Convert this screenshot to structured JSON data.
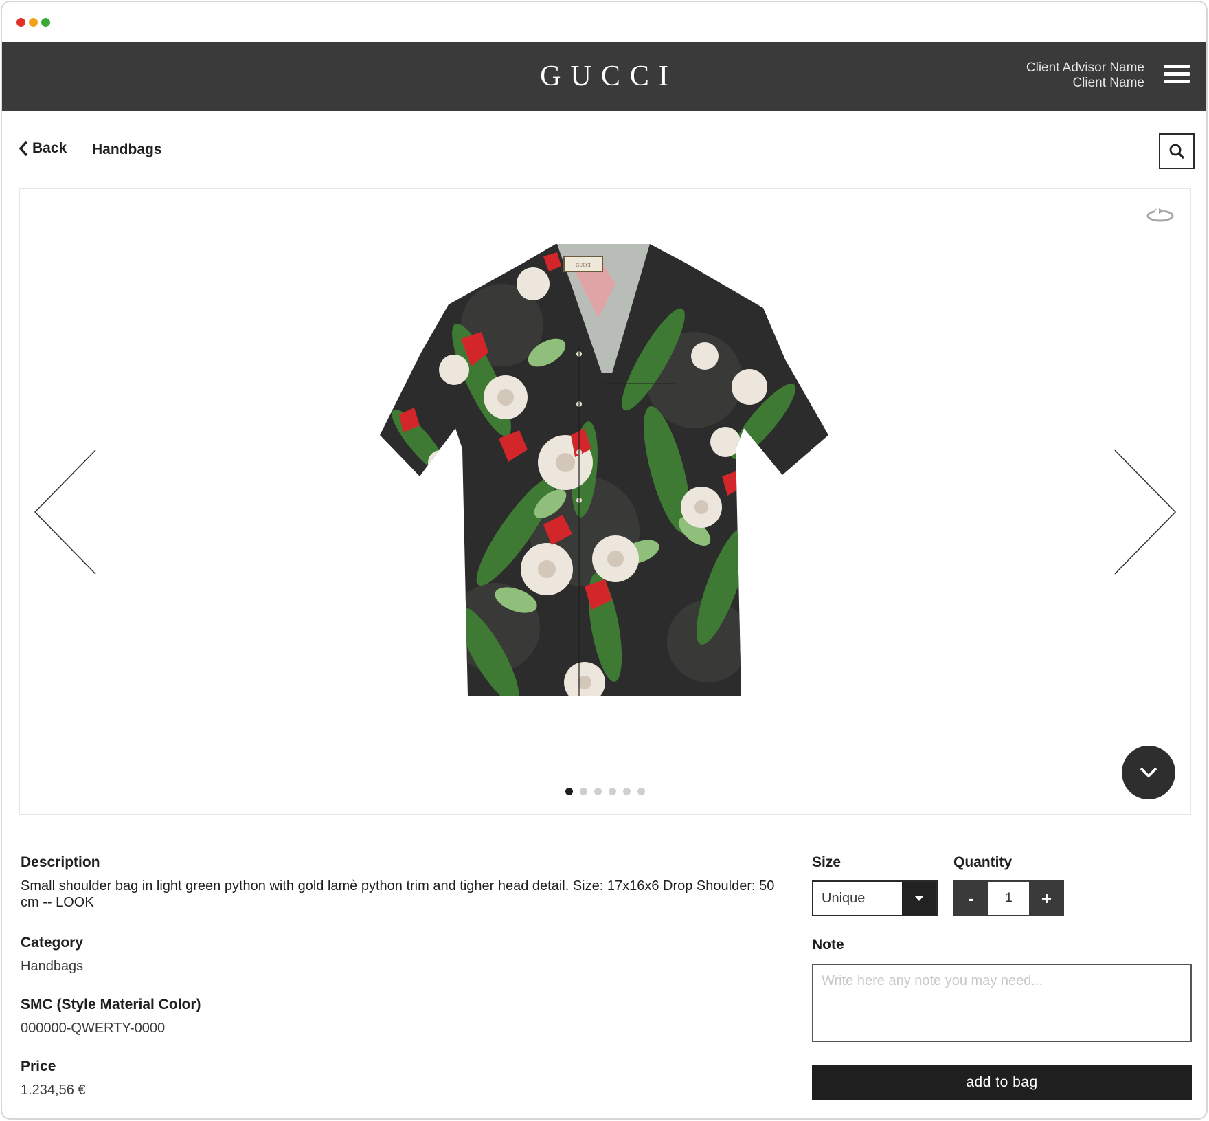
{
  "window": {
    "dot_colors": [
      "#e0312b",
      "#f2a11b",
      "#3aaa36"
    ]
  },
  "header": {
    "brand": "GUCCI",
    "advisor_name": "Client Advisor Name",
    "client_name": "Client Name"
  },
  "subnav": {
    "back_label": "Back",
    "breadcrumb": "Handbags"
  },
  "gallery": {
    "image_count": 6,
    "active_index": 0
  },
  "product": {
    "description_label": "Description",
    "description": "Small shoulder bag in light green python with gold lamè python trim and tigher head detail. Size: 17x16x6 Drop Shoulder: 50 cm -- LOOK",
    "category_label": "Category",
    "category": "Handbags",
    "smc_label": "SMC (Style Material Color)",
    "smc": "000000-QWERTY-0000",
    "price_label": "Price",
    "price": "1.234,56 €"
  },
  "order": {
    "size_label": "Size",
    "size_value": "Unique",
    "quantity_label": "Quantity",
    "quantity_minus": "-",
    "quantity_value": "1",
    "quantity_plus": "+",
    "note_label": "Note",
    "note_placeholder": "Write here any note you may need...",
    "add_to_bag": "add to bag"
  },
  "colors": {
    "header_bg": "#3a3a3a",
    "button_dark": "#1f1f1f",
    "text": "#1f1f1f"
  }
}
